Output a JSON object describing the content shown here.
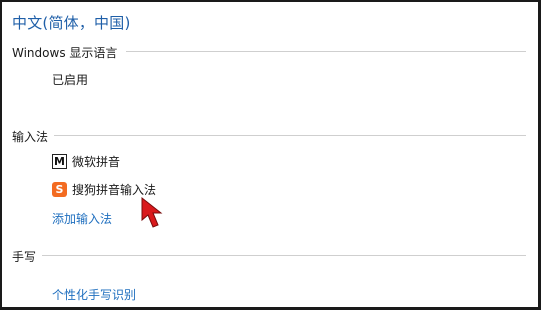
{
  "page_title": "中文(简体，中国)",
  "display_language": {
    "heading": "Windows 显示语言",
    "status": "已启用"
  },
  "input_methods": {
    "heading": "输入法",
    "items": [
      {
        "label": "微软拼音",
        "icon": "microsoft-pinyin-icon",
        "icon_glyph": "M"
      },
      {
        "label": "搜狗拼音输入法",
        "icon": "sogou-pinyin-icon",
        "icon_glyph": "S"
      }
    ],
    "add_link": "添加输入法"
  },
  "handwriting": {
    "heading": "手写",
    "personalize_link": "个性化手写识别"
  },
  "colors": {
    "title": "#1f5fa8",
    "link": "#1f6fbf",
    "sogou_icon": "#f36b21",
    "cursor": "#d9191c"
  }
}
